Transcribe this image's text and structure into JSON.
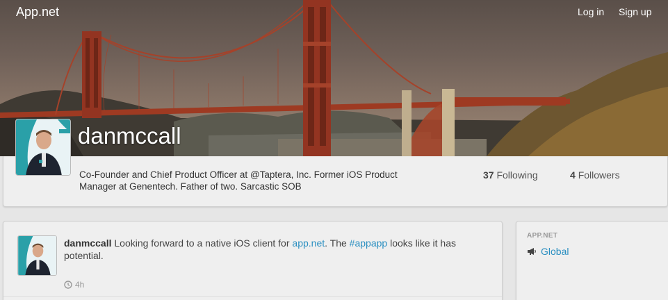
{
  "topbar": {
    "brand": "App.net",
    "login_label": "Log in",
    "signup_label": "Sign up"
  },
  "profile": {
    "username": "danmccall",
    "bio": "Co-Founder and Chief Product Officer at @Taptera, Inc. Former iOS Product Manager at Genentech. Father of two. Sarcastic SOB",
    "following_count": "37",
    "following_label": "Following",
    "followers_count": "4",
    "followers_label": "Followers"
  },
  "post": {
    "user": "danmccall",
    "text_before": "Looking forward to a native iOS client for",
    "link_domain": "app.net",
    "text_middle": ". The",
    "hashtag": "#appapp",
    "text_after": "looks like it has potential.",
    "time": "4h"
  },
  "sidebar": {
    "heading": "APP.NET",
    "items": [
      {
        "label": "Global",
        "icon": "megaphone-icon"
      }
    ]
  },
  "colors": {
    "link": "#2a8fc1",
    "card_bg": "#efefef",
    "page_bg": "#e6e6e6"
  }
}
